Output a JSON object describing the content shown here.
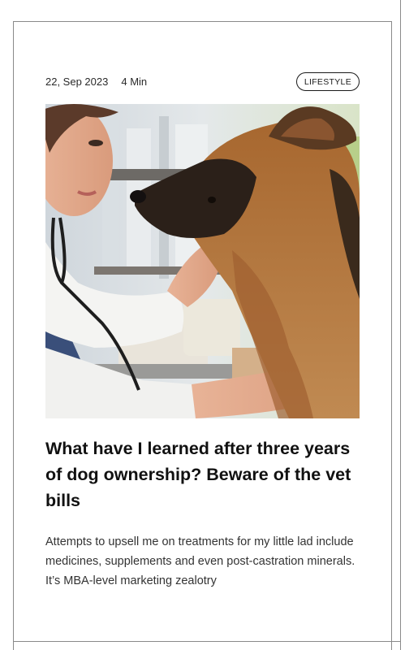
{
  "article": {
    "date": "22, Sep 2023",
    "read_time": "4 Min",
    "category": "LIFESTYLE",
    "title": "What have I learned after three years of dog ownership? Beware of the vet bills",
    "excerpt": "Attempts to upsell me on treatments for my little lad include medicines, supplements and even post-castration minerals. It’s MBA-level marketing zealotry",
    "image_icon": "photo-vet-with-german-shepherd"
  },
  "colors": {
    "text": "#111111",
    "border": "#8a8a8a",
    "background": "#ffffff"
  }
}
